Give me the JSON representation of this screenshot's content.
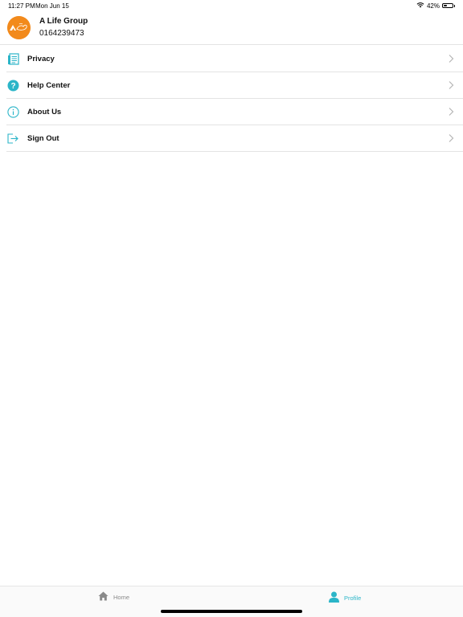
{
  "status_bar": {
    "time": "11:27 PM",
    "date": "Mon Jun 15",
    "battery_text": "42%",
    "battery_level": 0.42,
    "wifi_icon": "wifi-icon"
  },
  "profile": {
    "name": "A Life Group",
    "phone": "0164239473",
    "avatar_color": "#f28a1c"
  },
  "menu": {
    "items": [
      {
        "label": "Privacy",
        "icon": "document-icon"
      },
      {
        "label": "Help Center",
        "icon": "question-icon"
      },
      {
        "label": "About Us",
        "icon": "info-icon"
      },
      {
        "label": "Sign Out",
        "icon": "sign-out-icon"
      }
    ]
  },
  "tab_bar": {
    "tabs": [
      {
        "label": "Home",
        "icon": "home-icon",
        "active": false
      },
      {
        "label": "Profile",
        "icon": "profile-icon",
        "active": true
      }
    ]
  },
  "colors": {
    "accent": "#2bb5c8",
    "inactive": "#8a8a8a"
  }
}
